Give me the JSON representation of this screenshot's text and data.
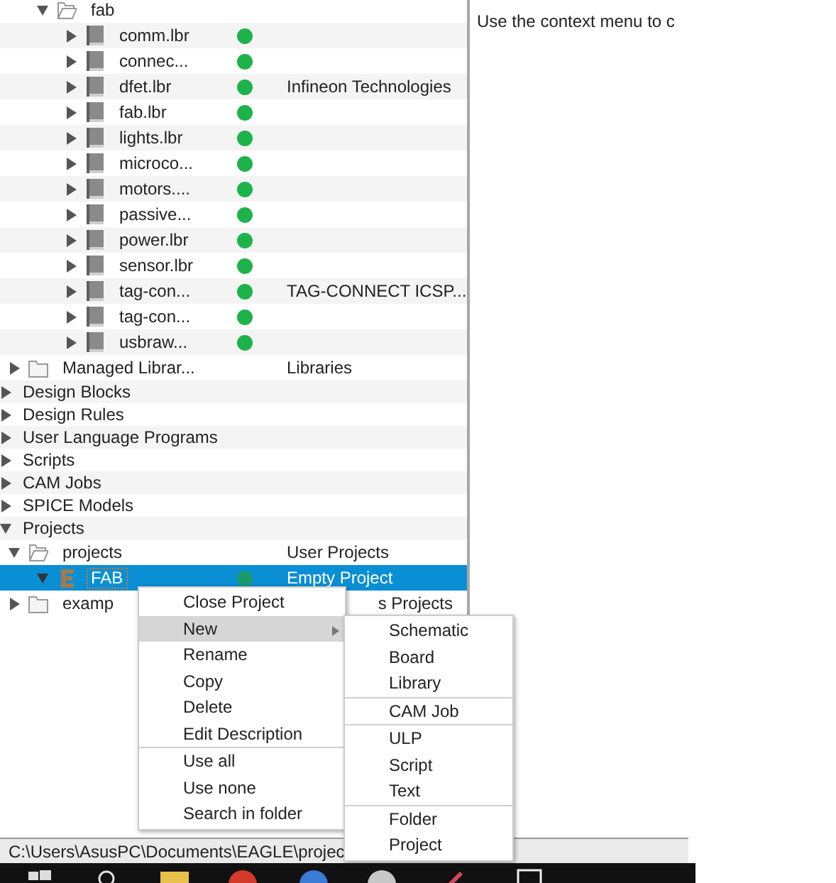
{
  "tree": [
    {
      "children": [
        {
          "children": [
            {
              "label": "fab",
              "kind": "folder",
              "expanded": true,
              "selected": false,
              "children": [
                {
                  "label": "comm.lbr",
                  "kind": "library",
                  "expanded": false,
                  "selected": false,
                  "in_use": true
                },
                {
                  "label": "connec...",
                  "kind": "library",
                  "expanded": false,
                  "selected": false,
                  "in_use": true
                },
                {
                  "label": "dfet.lbr",
                  "kind": "library",
                  "expanded": false,
                  "selected": false,
                  "in_use": true,
                  "description": "Infineon Technologies"
                },
                {
                  "label": "fab.lbr",
                  "kind": "library",
                  "expanded": false,
                  "selected": false,
                  "in_use": true
                },
                {
                  "label": "lights.lbr",
                  "kind": "library",
                  "expanded": false,
                  "selected": false,
                  "in_use": true
                },
                {
                  "label": "microco...",
                  "kind": "library",
                  "expanded": false,
                  "selected": false,
                  "in_use": true
                },
                {
                  "label": "motors....",
                  "kind": "library",
                  "expanded": false,
                  "selected": false,
                  "in_use": true
                },
                {
                  "label": "passive...",
                  "kind": "library",
                  "expanded": false,
                  "selected": false,
                  "in_use": true
                },
                {
                  "label": "power.lbr",
                  "kind": "library",
                  "expanded": false,
                  "selected": false,
                  "in_use": true
                },
                {
                  "label": "sensor.lbr",
                  "kind": "library",
                  "expanded": false,
                  "selected": false,
                  "in_use": true
                },
                {
                  "label": "tag-con...",
                  "kind": "library",
                  "expanded": false,
                  "selected": false,
                  "in_use": true,
                  "description": "TAG-CONNECT ICSP..."
                },
                {
                  "label": "tag-con...",
                  "kind": "library",
                  "expanded": false,
                  "selected": false,
                  "in_use": true
                },
                {
                  "label": "usbraw...",
                  "kind": "library",
                  "expanded": false,
                  "selected": false,
                  "in_use": true
                }
              ]
            }
          ]
        },
        {
          "label": "Managed Librar...",
          "kind": "folder",
          "expanded": false,
          "selected": false,
          "description": "Libraries"
        }
      ]
    },
    {
      "label": "Design Blocks",
      "kind": "category",
      "expanded": false,
      "selected": false
    },
    {
      "label": "Design Rules",
      "kind": "category",
      "expanded": false,
      "selected": false
    },
    {
      "label": "User Language Programs",
      "kind": "category",
      "expanded": false,
      "selected": false
    },
    {
      "label": "Scripts",
      "kind": "category",
      "expanded": false,
      "selected": false
    },
    {
      "label": "CAM Jobs",
      "kind": "category",
      "expanded": false,
      "selected": false
    },
    {
      "label": "SPICE Models",
      "kind": "category",
      "expanded": false,
      "selected": false
    },
    {
      "label": "Projects",
      "kind": "category",
      "expanded": true,
      "selected": false,
      "children": [
        {
          "label": "projects",
          "kind": "folder",
          "expanded": true,
          "selected": false,
          "description": "User Projects",
          "children": [
            {
              "label": "FAB",
              "kind": "project",
              "expanded": true,
              "selected": true,
              "in_use": true,
              "description": "Empty Project"
            }
          ]
        },
        {
          "label": "examp",
          "kind": "folder",
          "expanded": false,
          "selected": false,
          "description": "s Projects"
        }
      ]
    }
  ],
  "info_text": "Use the context menu to c",
  "context_menu": {
    "items": [
      {
        "label": "Close Project",
        "highlighted": false,
        "separator_before": false,
        "has_submenu": false
      },
      {
        "label": "New",
        "highlighted": true,
        "separator_before": false,
        "has_submenu": true
      },
      {
        "label": "Rename",
        "highlighted": false,
        "separator_before": false,
        "has_submenu": false
      },
      {
        "label": "Copy",
        "highlighted": false,
        "separator_before": false,
        "has_submenu": false
      },
      {
        "label": "Delete",
        "highlighted": false,
        "separator_before": false,
        "has_submenu": false
      },
      {
        "label": "Edit Description",
        "highlighted": false,
        "separator_before": false,
        "has_submenu": false
      },
      {
        "label": "Use all",
        "highlighted": false,
        "separator_before": true,
        "has_submenu": false
      },
      {
        "label": "Use none",
        "highlighted": false,
        "separator_before": false,
        "has_submenu": false
      },
      {
        "label": "Search in folder",
        "highlighted": false,
        "separator_before": false,
        "has_submenu": false
      }
    ]
  },
  "submenu": {
    "items": [
      {
        "label": "Schematic",
        "separator_before": false
      },
      {
        "label": "Board",
        "separator_before": false
      },
      {
        "label": "Library",
        "separator_before": false
      },
      {
        "label": "CAM Job",
        "separator_before": true
      },
      {
        "label": "ULP",
        "separator_before": true
      },
      {
        "label": "Script",
        "separator_before": false
      },
      {
        "label": "Text",
        "separator_before": false
      },
      {
        "label": "Folder",
        "separator_before": true
      },
      {
        "label": "Project",
        "separator_before": false
      }
    ]
  },
  "status_bar": {
    "path": "C:\\Users\\AsusPC\\Documents\\EAGLE\\projec"
  }
}
